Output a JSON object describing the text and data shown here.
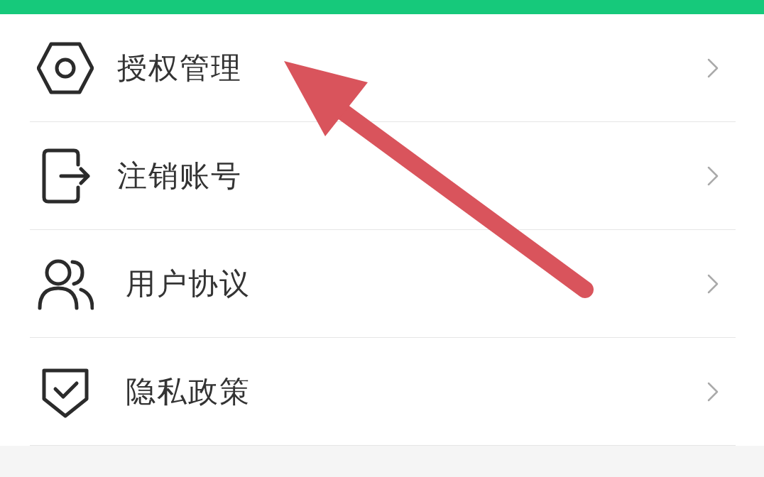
{
  "menu": {
    "items": [
      {
        "label": "授权管理",
        "kind": "hexagon"
      },
      {
        "label": "注销账号",
        "kind": "exit"
      },
      {
        "label": "用户协议",
        "kind": "users"
      },
      {
        "label": "隐私政策",
        "kind": "shield"
      }
    ]
  }
}
